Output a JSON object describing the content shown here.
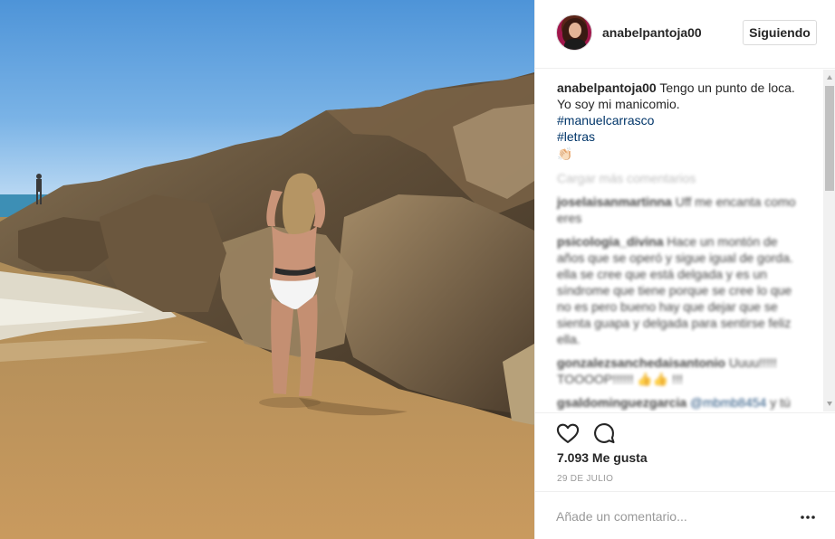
{
  "post": {
    "username": "anabelpantoja00",
    "follow_label": "Siguiendo",
    "caption_text": "Tengo un punto de loca. Yo soy mi manicomio.",
    "hashtags": [
      "#manuelcarrasco",
      "#letras"
    ],
    "caption_emoji": "👏🏻",
    "load_more_label": "Cargar más comentarios",
    "likes_label": "7.093 Me gusta",
    "date_label": "29 DE JULIO",
    "add_comment_placeholder": "Añade un comentario...",
    "more_options": "···"
  },
  "comments": [
    {
      "user": "joselaisanmartinna",
      "text": "Uff me encanta como eres"
    },
    {
      "user": "psicologia_divina",
      "text": "Hace un montón de años que se operó y sigue igual de gorda. ella se cree que está delgada y es un síndrome que tiene porque se cree lo que no es pero bueno hay que dejar que se sienta guapa y delgada para sentirse feliz ella."
    },
    {
      "user": "gonzalezsanchedaisantonio",
      "text": "Uuuu!!!!! TOOOOP!!!!!! 👍👍 !!!"
    },
    {
      "user": "gsaldominguezgarcia",
      "mention": "@mbmb8454",
      "text": "y tú eres mas fea que un mono y te crees bonita"
    }
  ],
  "icons": {
    "like": "heart-outline-icon",
    "comment": "speech-bubble-icon",
    "more": "ellipsis-icon"
  },
  "colors": {
    "link": "#003569",
    "border": "#efefef",
    "muted": "#999999"
  }
}
